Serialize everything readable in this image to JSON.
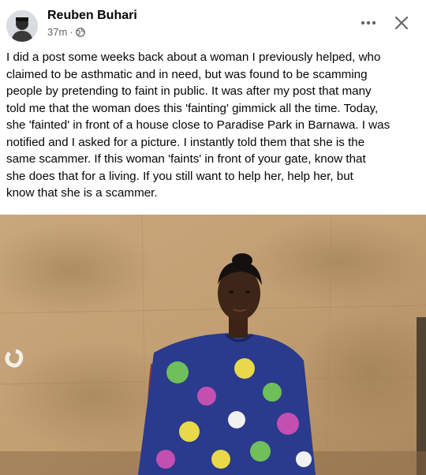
{
  "post": {
    "author": "Reuben Buhari",
    "timestamp": "37m",
    "separator": "·",
    "audience_icon": "globe-icon",
    "more_icon": "more-horizontal-icon",
    "close_icon": "close-icon",
    "text_lines": [
      "I did a post some weeks back about a woman I previously helped, who",
      "claimed to be asthmatic and in need, but was found to be scamming",
      "people by pretending to faint in public. It was after my post that many",
      "told me that the woman does this 'fainting' gimmick all the time. Today,",
      "she 'fainted' in front of a house close to Paradise Park in Barnawa. I was",
      "notified and I asked for a picture. I instantly told them that she is the",
      "same scammer. If this woman 'faints' in front of your gate, know that",
      "she does that for a living. If you still want to help her, help her, but",
      "know that she is a scammer."
    ],
    "photo_alt": ""
  },
  "colors": {
    "text_primary": "#050505",
    "text_secondary": "#65676b",
    "wall": "#c8a77e",
    "dress_blue": "#2a3a8c"
  }
}
